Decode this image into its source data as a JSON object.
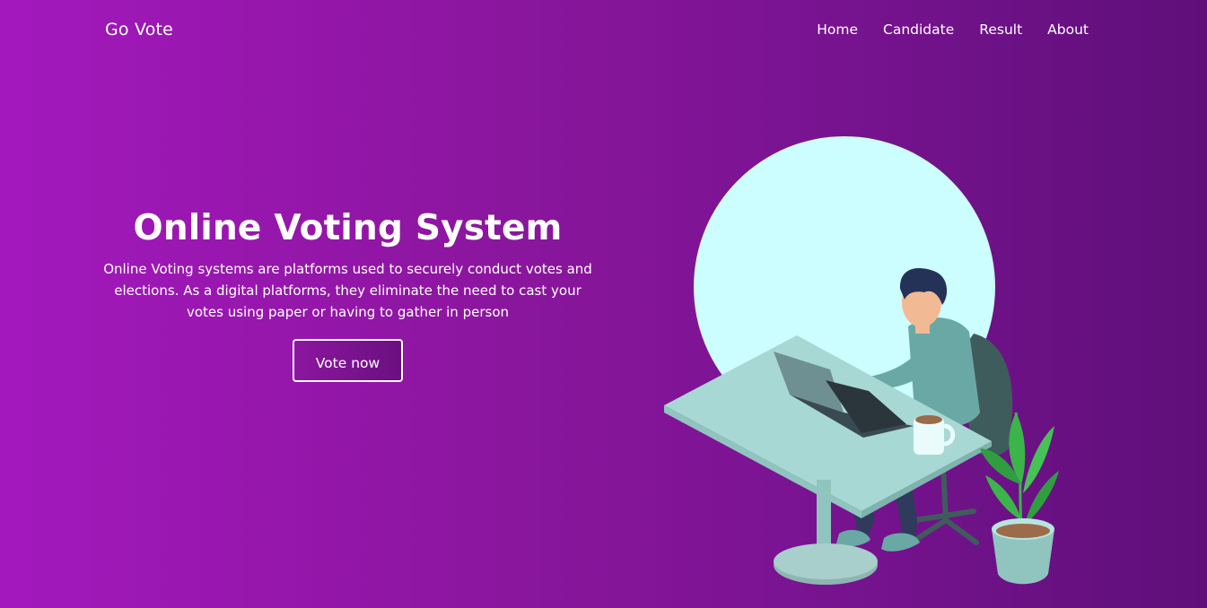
{
  "brand": {
    "name": "Go Vote"
  },
  "nav": {
    "items": [
      {
        "label": "Home"
      },
      {
        "label": "Candidate"
      },
      {
        "label": "Result"
      },
      {
        "label": "About"
      }
    ]
  },
  "hero": {
    "title": "Online Voting System",
    "description": "Online Voting systems are platforms used to securely conduct votes and elections. As a digital platforms, they eliminate the need to cast your votes using paper or having to gather in person",
    "cta_label": "Vote now"
  },
  "illustration": {
    "subject": "person-at-desk-with-laptop",
    "colors": {
      "circle": "#ccfdff",
      "desk": "#a8d8d4",
      "shirt": "#6aa8a6",
      "chair": "#3f5c5c",
      "plant": "#3bb54a"
    }
  },
  "theme": {
    "gradient_start": "#a318bd",
    "gradient_end": "#5f0f7a",
    "text": "#ffffff"
  }
}
